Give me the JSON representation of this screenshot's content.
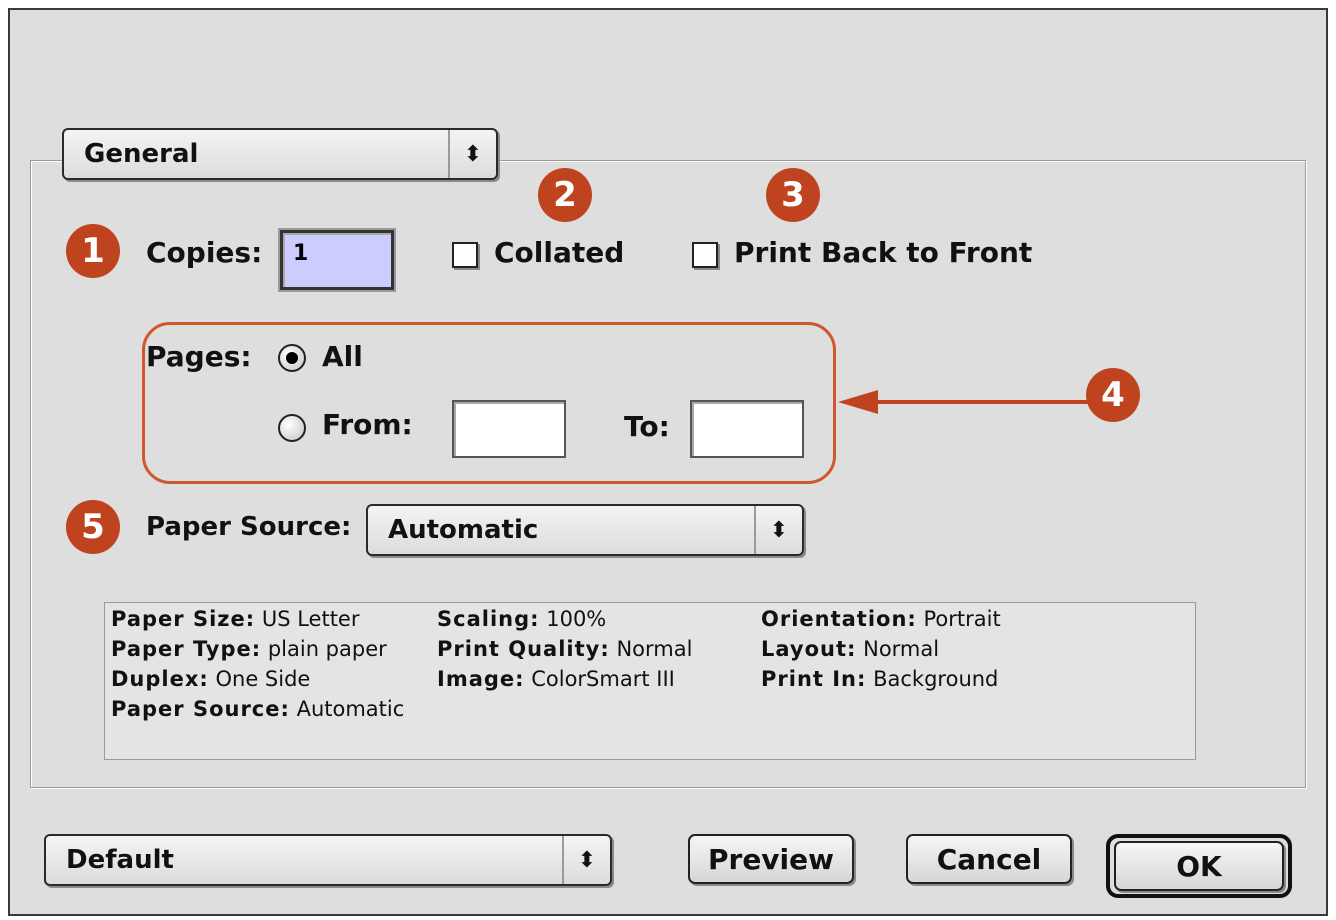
{
  "dialog": {
    "panel_popup": {
      "value": "General",
      "icon": "up-down-arrows-icon"
    },
    "copies": {
      "label": "Copies:",
      "value": "1"
    },
    "collated": {
      "label": "Collated",
      "checked": false
    },
    "back_to_front": {
      "label": "Print Back to Front",
      "checked": false
    },
    "pages": {
      "label": "Pages:",
      "all_label": "All",
      "all_selected": true,
      "from_label": "From:",
      "from_value": "",
      "to_label": "To:",
      "to_value": ""
    },
    "paper_source": {
      "label": "Paper Source:",
      "value": "Automatic",
      "icon": "up-down-arrows-icon"
    },
    "summary": {
      "paper_size_label": "Paper Size:",
      "paper_size_value": "US Letter",
      "scaling_label": "Scaling:",
      "scaling_value": "100%",
      "orientation_label": "Orientation:",
      "orientation_value": "Portrait",
      "paper_type_label": "Paper Type:",
      "paper_type_value": "plain paper",
      "print_quality_label": "Print Quality:",
      "print_quality_value": "Normal",
      "layout_label": "Layout:",
      "layout_value": "Normal",
      "duplex_label": "Duplex:",
      "duplex_value": "One Side",
      "image_label": "Image:",
      "image_value": "ColorSmart III",
      "print_in_label": "Print In:",
      "print_in_value": "Background",
      "paper_source_label": "Paper Source:",
      "paper_source_value": "Automatic"
    },
    "settings_popup": {
      "value": "Default",
      "icon": "up-down-arrows-icon"
    },
    "buttons": {
      "preview": "Preview",
      "cancel": "Cancel",
      "ok": "OK"
    }
  },
  "callouts": [
    "1",
    "2",
    "3",
    "4",
    "5"
  ],
  "colors": {
    "callout": "#c0431f",
    "highlight_border": "#d0562b",
    "copies_field": "#ccccff",
    "dialog_bg": "#dedede"
  }
}
